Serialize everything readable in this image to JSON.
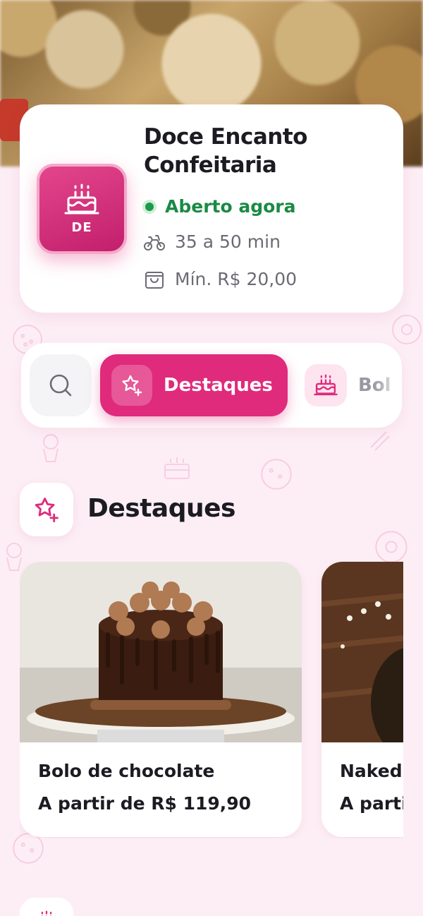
{
  "store": {
    "name": "Doce Encanto Confeitaria",
    "logo_text": "DE",
    "logo_icon": "cake-icon",
    "status": "Aberto agora",
    "delivery_time": "35 a 50 min",
    "delivery_icon": "bike-icon",
    "minimum_order": "Mín. R$ 20,00",
    "minimum_icon": "bag-icon"
  },
  "categories": {
    "search_icon": "search-icon",
    "items": [
      {
        "label": "Destaques",
        "icon": "star-icon",
        "active": true
      },
      {
        "label": "Bol",
        "icon": "cake-icon",
        "active": false
      }
    ]
  },
  "section": {
    "title": "Destaques",
    "icon": "star-icon"
  },
  "products": [
    {
      "name": "Bolo de chocolate",
      "price": "A partir de R$ 119,90"
    },
    {
      "name": "Naked",
      "price": "A parti"
    }
  ],
  "colors": {
    "accent": "#e02a7c",
    "status_green": "#1b8a44",
    "background": "#fdeef5"
  }
}
